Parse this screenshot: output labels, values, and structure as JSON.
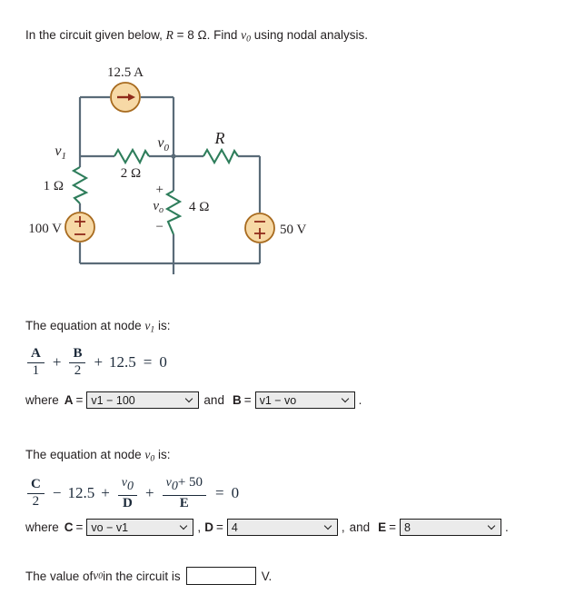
{
  "problem": {
    "statement_pre": "In the circuit given below, ",
    "statement_r": "R",
    "statement_mid": " = 8 Ω. Find ",
    "statement_v": "v",
    "statement_v_sub": "0",
    "statement_post": " using nodal analysis."
  },
  "circuit": {
    "current_source_label": "12.5 A",
    "node1_label": "v",
    "node1_sub": "1",
    "node0_label": "v",
    "node0_sub": "0",
    "r_label": "R",
    "r2_label": "2 Ω",
    "r1_label": "1 Ω",
    "r4_label": "4 Ω",
    "vo_across_label": "v",
    "vo_across_sub": "o",
    "plus_sign": "+",
    "minus_sign": "−",
    "source_100_label": "100 V",
    "source_50_label": "50 V",
    "source_100_top": "+",
    "source_100_bottom": "−",
    "source_50_top": "−",
    "source_50_bottom": "+",
    "wire_color": "#5a6b78",
    "resistor_color": "#2e7d5b",
    "source_fill": "#f7d9a6",
    "source_stroke": "#a86b1f",
    "arrow_color": "#8f2a1a",
    "ground_color": "#2b4a45"
  },
  "eq1": {
    "lead_pre": "The equation at node ",
    "lead_var": "v",
    "lead_sub": "1",
    "lead_post": " is:",
    "num_a": "A",
    "den_a": "1",
    "op1": "+",
    "num_b": "B",
    "den_b": "2",
    "op2": "+",
    "const": "12.5",
    "equals": "=",
    "rhs": "0",
    "where": "where",
    "label_a": "A",
    "eq_a": "=",
    "value_a": "v1 − 100",
    "and": "and",
    "label_b": "B",
    "eq_b": "=",
    "value_b": "v1 − vo",
    "period": "."
  },
  "eq2": {
    "lead_pre": "The equation at node ",
    "lead_var": "v",
    "lead_sub": "0",
    "lead_post": " is:",
    "num_c": "C",
    "den_c": "2",
    "op1": "−",
    "const": "12.5",
    "op2": "+",
    "num_v": "v",
    "num_v_sub": "0",
    "den_d": "D",
    "op3": "+",
    "num_v50_v": "v",
    "num_v50_sub": "0",
    "num_v50_rest": "+ 50",
    "den_e": "E",
    "equals": "=",
    "rhs": "0",
    "where": "where",
    "label_c": "C",
    "eq_c": "=",
    "value_c": "vo − v1",
    "comma1": ",",
    "label_d": "D",
    "eq_d": "=",
    "value_d": "4",
    "comma2": ",",
    "and": "and",
    "label_e": "E",
    "eq_e": "=",
    "value_e": "8",
    "period": "."
  },
  "answer": {
    "pre": "The value of ",
    "var": "v",
    "var_sub": "0",
    "mid": " in the circuit is",
    "value": "",
    "unit": "V."
  }
}
